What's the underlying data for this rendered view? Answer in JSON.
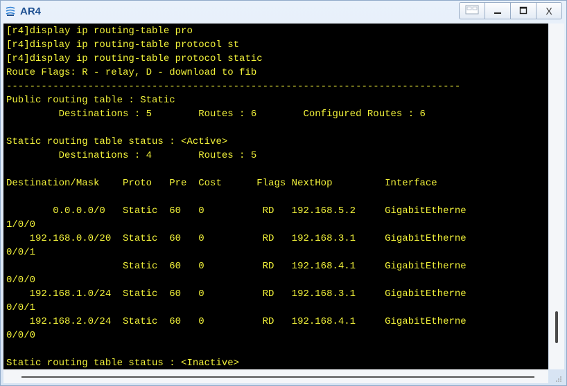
{
  "window": {
    "title": "AR4",
    "minimize_label": "—",
    "maximize_label": "☐",
    "close_label": "X"
  },
  "terminal": {
    "lines": [
      "[r4]display ip routing-table pro",
      "[r4]display ip routing-table protocol st",
      "[r4]display ip routing-table protocol static",
      "Route Flags: R - relay, D - download to fib",
      "------------------------------------------------------------------------------",
      "Public routing table : Static",
      "         Destinations : 5        Routes : 6        Configured Routes : 6",
      "",
      "Static routing table status : <Active>",
      "         Destinations : 4        Routes : 5",
      "",
      "Destination/Mask    Proto   Pre  Cost      Flags NextHop         Interface",
      "",
      "        0.0.0.0/0   Static  60   0          RD   192.168.5.2     GigabitEtherne",
      "1/0/0",
      "    192.168.0.0/20  Static  60   0          RD   192.168.3.1     GigabitEtherne",
      "0/0/1",
      "                    Static  60   0          RD   192.168.4.1     GigabitEtherne",
      "0/0/0",
      "    192.168.1.0/24  Static  60   0          RD   192.168.3.1     GigabitEtherne",
      "0/0/1",
      "    192.168.2.0/24  Static  60   0          RD   192.168.4.1     GigabitEtherne",
      "0/0/0",
      "",
      "Static routing table status : <Inactive>"
    ]
  },
  "colors": {
    "terminal_bg": "#000000",
    "terminal_text": "#f2f23a",
    "title_text": "#1d4f91"
  },
  "icons": {
    "app": "router-icon",
    "restore": "restore-icon",
    "minimize": "minimize-icon",
    "maximize": "maximize-icon",
    "close": "close-icon"
  }
}
